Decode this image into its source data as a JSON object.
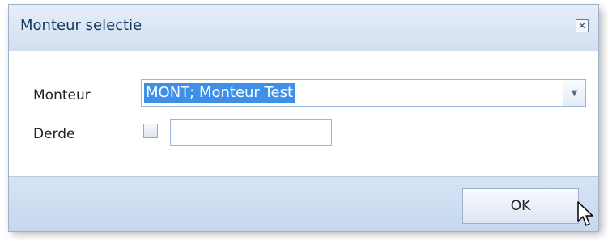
{
  "dialog": {
    "title": "Monteur selectie",
    "close_icon": "close-icon"
  },
  "form": {
    "monteur_label": "Monteur",
    "monteur_value": "MONT; Monteur Test",
    "derde_label": "Derde",
    "derde_checked": false,
    "derde_value": ""
  },
  "footer": {
    "ok_label": "OK"
  },
  "colors": {
    "selection": "#3d8fe8",
    "title_text": "#15395f",
    "frame_border": "#98b2d0"
  }
}
